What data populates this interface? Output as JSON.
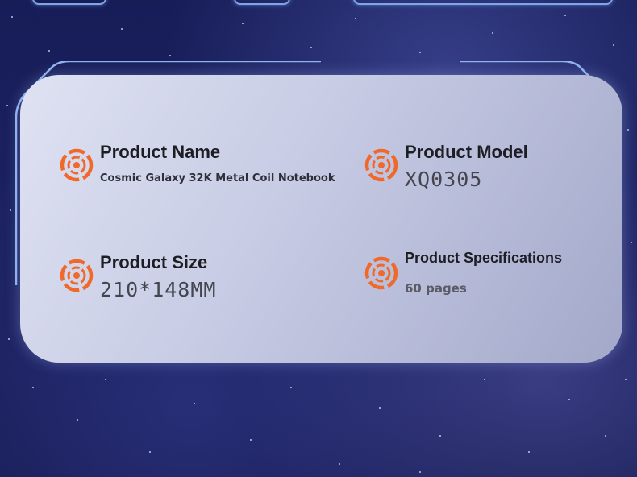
{
  "colors": {
    "accent_orange": "#f0682a",
    "frame_blue": "#7ea6e6"
  },
  "icon_name": "orange-gear-ring-icon",
  "bracket_open": "",
  "bracket_close": "",
  "items": [
    {
      "label": "Product Name",
      "value": "Cosmic Galaxy 32K Metal Coil Notebook"
    },
    {
      "label": "Product Model",
      "value": "XQ0305"
    },
    {
      "label": "Product Size",
      "value": "210*148MM"
    },
    {
      "label": "Product Specifications",
      "value": "60 pages"
    }
  ]
}
